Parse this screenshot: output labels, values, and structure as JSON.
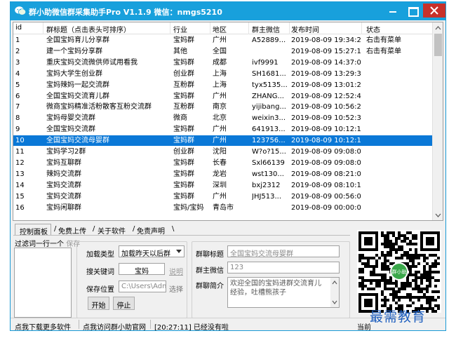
{
  "window": {
    "title": "群小助微信群采集助手Pro V1.1.9  微信：nmgs5210"
  },
  "table": {
    "columns": [
      "id",
      "群标题（点击表头可排序）",
      "行业",
      "地区",
      "群主微信",
      "发布时间",
      "状态"
    ],
    "rows": [
      {
        "id": "1",
        "title": "全国宝妈育儿分享群",
        "industry": "宝妈群",
        "region": "广州",
        "wechat": "A52889...",
        "time": "2019-08-09 19:34:21",
        "status": "右击有菜单"
      },
      {
        "id": "2",
        "title": "建一个宝妈分享群",
        "industry": "其他",
        "region": "全国",
        "wechat": "",
        "time": "2019-08-09 15:27:11",
        "status": "右击有菜单"
      },
      {
        "id": "3",
        "title": "重庆宝妈交流微供师试用看我",
        "industry": "宝妈群",
        "region": "成都",
        "wechat": "ivf9991",
        "time": "2019-08-09 14:37:03",
        "status": ""
      },
      {
        "id": "4",
        "title": "宝妈大学生创业群",
        "industry": "创业群",
        "region": "上海",
        "wechat": "SH1681...",
        "time": "2019-08-09 13:29:39",
        "status": ""
      },
      {
        "id": "5",
        "title": "宝妈辣妈一起交流群",
        "industry": "互粉群",
        "region": "上海",
        "wechat": "tyx5135...",
        "time": "2019-08-09 13:01:26",
        "status": ""
      },
      {
        "id": "6",
        "title": "全国宝妈交流育儿群",
        "industry": "宝妈群",
        "region": "广州",
        "wechat": "ZHANG...",
        "time": "2019-08-09 12:52:44",
        "status": ""
      },
      {
        "id": "7",
        "title": "微商宝妈精准活粉散客互粉交流群",
        "industry": "互粉群",
        "region": "南京",
        "wechat": "yijibang...",
        "time": "2019-08-09 10:56:21",
        "status": ""
      },
      {
        "id": "8",
        "title": "宝妈母婴交流群",
        "industry": "微商",
        "region": "北京",
        "wechat": "weixin3...",
        "time": "2019-08-09 10:52:31",
        "status": ""
      },
      {
        "id": "9",
        "title": "全国宝妈交流群",
        "industry": "宝妈群",
        "region": "广州",
        "wechat": "641913...",
        "time": "2019-08-09 10:12:14",
        "status": ""
      },
      {
        "id": "10",
        "title": "全国宝妈交流母婴群",
        "industry": "宝妈群",
        "region": "广州",
        "wechat": "123756...",
        "time": "2019-08-09 10:12:14",
        "status": ""
      },
      {
        "id": "11",
        "title": "宝妈学习2群",
        "industry": "创业群",
        "region": "沈阳",
        "wechat": "W?o?15...",
        "time": "2019-08-09 09:08:07",
        "status": ""
      },
      {
        "id": "12",
        "title": "宝妈互聊群",
        "industry": "宝妈群",
        "region": "长春",
        "wechat": "Sxl66139",
        "time": "2019-08-09 09:08:07",
        "status": ""
      },
      {
        "id": "13",
        "title": "辣妈交流群",
        "industry": "宝妈群",
        "region": "龙岩",
        "wechat": "wst130...",
        "time": "2019-08-09 08:21:04",
        "status": ""
      },
      {
        "id": "14",
        "title": "宝妈交流群",
        "industry": "宝妈群",
        "region": "深圳",
        "wechat": "bxj2312",
        "time": "2019-08-09 08:10:19",
        "status": ""
      },
      {
        "id": "15",
        "title": "宝妈交流群",
        "industry": "宝妈群",
        "region": "广州",
        "wechat": "JHJ513...",
        "time": "2019-08-09 00:56:04",
        "status": ""
      },
      {
        "id": "16",
        "title": "宝妈闲聊群",
        "industry": "宝妈/宝妈",
        "region": "青岛市",
        "wechat": "",
        "time": "2019-08-09 00:00:00",
        "status": ""
      }
    ],
    "selected_index": 9
  },
  "tabs": [
    "控制面板",
    "免费上传",
    "关于软件",
    "免责声明"
  ],
  "panel": {
    "filter_label": "过滤词一行一个",
    "filter_save": "保存",
    "load_type_label": "加载类型",
    "load_type_value": "加载昨天以后群",
    "keyword_label": "搜关键词",
    "keyword_value": "宝妈",
    "keyword_link": "说明",
    "save_path_label": "保存位置",
    "save_path_value": "C:\\Users\\Adm",
    "save_path_choose": "选择",
    "start_button": "开始",
    "stop_button": "停止",
    "group_title_label": "群聊标题",
    "group_title_value": "全国宝妈交流母婴群",
    "owner_wechat_label": "群主微信",
    "owner_wechat_value": "123",
    "intro_label": "群聊简介",
    "intro_value": "欢迎全国的宝妈进群交流育儿经验，吐槽熊孩子"
  },
  "qr": {
    "badge": "群小助"
  },
  "statusbar": {
    "download_more": "点我下载更多软件",
    "visit_site": "点我访问群小助官网",
    "log": "[20:27:11] 已经没有啦",
    "current_prefix": "当前"
  },
  "watermark": "最需教育",
  "colors": {
    "titlebar": "#18a0dc",
    "selection": "#0a78d7",
    "close": "#c7312a",
    "watermark": "#1f5fbf"
  }
}
